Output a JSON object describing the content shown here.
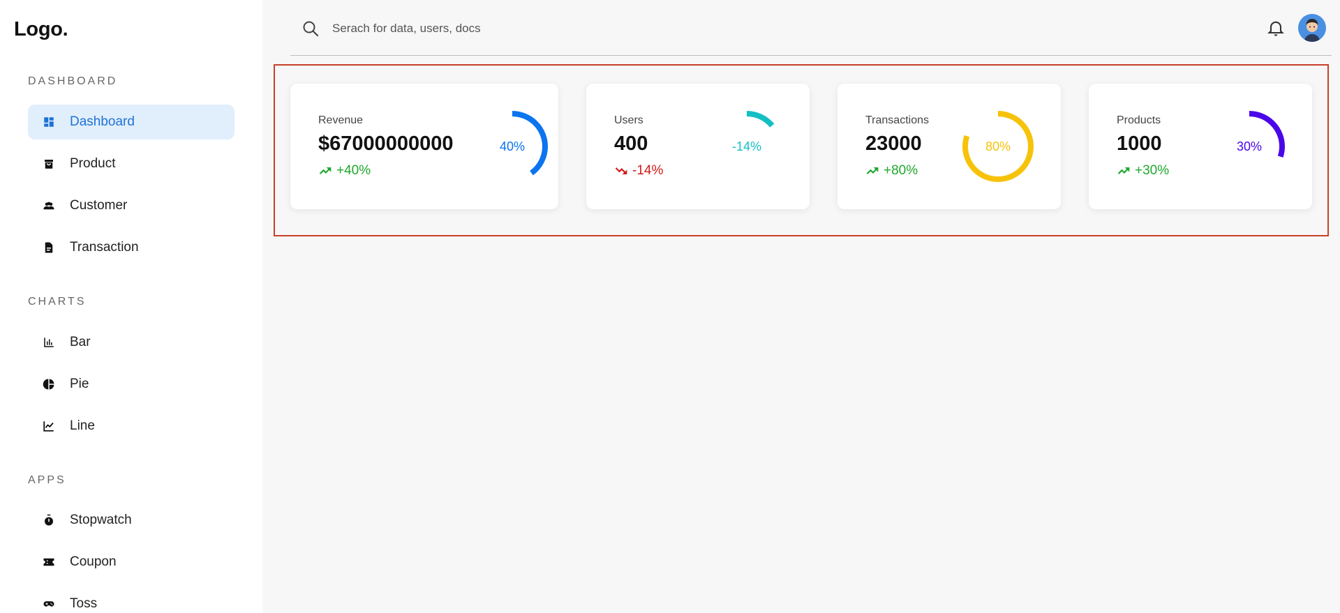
{
  "app": {
    "logo": "Logo."
  },
  "sidebar": {
    "sections": [
      {
        "title": "DASHBOARD",
        "items": [
          {
            "label": "Dashboard",
            "icon": "dashboard-icon",
            "active": true
          },
          {
            "label": "Product",
            "icon": "shopping-bag-icon"
          },
          {
            "label": "Customer",
            "icon": "people-icon"
          },
          {
            "label": "Transaction",
            "icon": "document-icon"
          }
        ]
      },
      {
        "title": "CHARTS",
        "items": [
          {
            "label": "Bar",
            "icon": "bar-chart-icon"
          },
          {
            "label": "Pie",
            "icon": "pie-chart-icon"
          },
          {
            "label": "Line",
            "icon": "line-chart-icon"
          }
        ]
      },
      {
        "title": "APPS",
        "items": [
          {
            "label": "Stopwatch",
            "icon": "stopwatch-icon"
          },
          {
            "label": "Coupon",
            "icon": "coupon-icon"
          },
          {
            "label": "Toss",
            "icon": "gamepad-icon"
          }
        ]
      }
    ]
  },
  "header": {
    "search_placeholder": "Serach for data, users, docs"
  },
  "widgets": [
    {
      "heading": "Revenue",
      "amount": "$67000000000",
      "change": "+40%",
      "trend": "up",
      "percent": 40,
      "percent_label": "40%",
      "color": "#0b74ef"
    },
    {
      "heading": "Users",
      "amount": "400",
      "change": "-14%",
      "trend": "down",
      "percent": -14,
      "percent_label": "-14%",
      "color": "#14bfc4"
    },
    {
      "heading": "Transactions",
      "amount": "23000",
      "change": "+80%",
      "trend": "up",
      "percent": 80,
      "percent_label": "80%",
      "color": "#f7c20a"
    },
    {
      "heading": "Products",
      "amount": "1000",
      "change": "+30%",
      "trend": "up",
      "percent": 30,
      "percent_label": "30%",
      "color": "#4a07e8"
    }
  ],
  "colors": {
    "up": "#1ea82c",
    "down": "#d41a1a",
    "active_bg": "#e1eefc",
    "active_text": "#1d73d6",
    "highlight": "#c8402a"
  }
}
